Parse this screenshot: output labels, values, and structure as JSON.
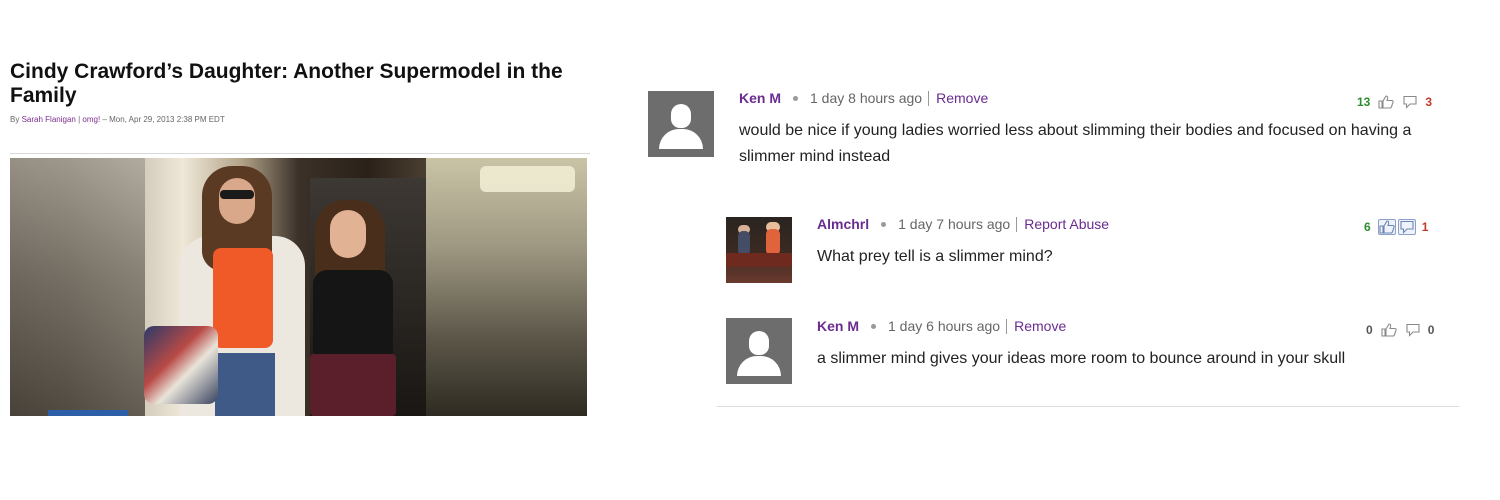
{
  "article": {
    "title": "Cindy Crawford’s Daughter: Another Supermodel in the Family",
    "byline_prefix": "By",
    "author": "Sarah Flanigan",
    "byline_sep": "|",
    "source": "omg!",
    "date": "– Mon, Apr 29, 2013 2:38 PM EDT"
  },
  "comments": [
    {
      "user": "Ken M",
      "time": "1 day 8 hours ago",
      "action": "Remove",
      "text": "would be nice if young ladies worried less about slimming their bodies and focused on having a slimmer mind instead",
      "thumbs_up": "13",
      "thumbs_down": "3"
    },
    {
      "user": "Almchrl",
      "time": "1 day 7 hours ago",
      "action": "Report Abuse",
      "text": "What prey tell is a slimmer mind?",
      "thumbs_up": "6",
      "thumbs_down": "1"
    },
    {
      "user": "Ken M",
      "time": "1 day 6 hours ago",
      "action": "Remove",
      "text": "a slimmer mind gives your ideas more room to bounce around in your skull",
      "thumbs_up": "0",
      "thumbs_down": "0"
    }
  ],
  "icons": {
    "thumbs_up": "👍",
    "thumbs_down": "💬"
  },
  "colors": {
    "username": "#6a2c91",
    "positive": "#2e8b2e",
    "negative": "#c0392b"
  }
}
